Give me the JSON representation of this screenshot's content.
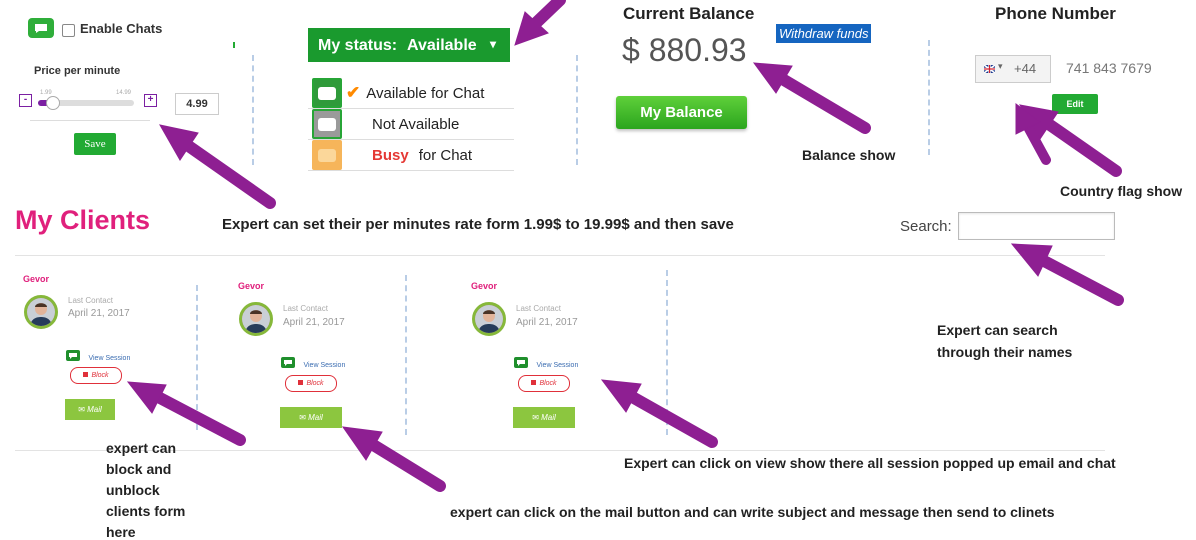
{
  "chat_settings": {
    "enable_label": "Enable Chats",
    "price_label": "Price per minute",
    "min_label": "1.99",
    "max_label": "14.99",
    "minus": "-",
    "plus": "+",
    "price_value": "4.99",
    "slider_level": 0.15,
    "save_label": "Save"
  },
  "status": {
    "header_label": "My status:",
    "current": "Available",
    "caret": "▾",
    "options": [
      {
        "label": "Available for Chat",
        "check": "✔"
      },
      {
        "label": "Not Available"
      },
      {
        "busy": "Busy",
        "label": "for Chat"
      }
    ]
  },
  "balance": {
    "title": "Current Balance",
    "amount": "$ 880.93",
    "withdraw_label": "Withdraw funds",
    "button_label": "My Balance"
  },
  "phone": {
    "title": "Phone Number",
    "flag_caret": "▾",
    "code": "+44",
    "number": "741 843 7679",
    "edit_label": "Edit"
  },
  "clients": {
    "title": "My Clients",
    "search_label": "Search:",
    "search_value": "",
    "items": [
      {
        "name": "Gevor",
        "last_contact_label": "Last Contact",
        "date": "April 21, 2017",
        "view_label": "View Session",
        "block_label": "Block",
        "mail_label": "Mail"
      },
      {
        "name": "Gevor",
        "last_contact_label": "Last Contact",
        "date": "April 21, 2017",
        "view_label": "View Session",
        "block_label": "Block",
        "mail_label": "Mail"
      },
      {
        "name": "Gevor",
        "last_contact_label": "Last Contact",
        "date": "April 21, 2017",
        "view_label": "View Session",
        "block_label": "Block",
        "mail_label": "Mail"
      }
    ]
  },
  "annotations": {
    "rate": "Expert can set their per minutes rate form 1.99$ to 19.99$ and then save",
    "balance": "Balance show",
    "flag": "Country flag show",
    "search_1": "Expert can search",
    "search_2": "through their names",
    "block_1": "expert can",
    "block_2": "block and",
    "block_3": "unblock",
    "block_4": "clients form",
    "block_5": "here",
    "view": "Expert can click on view show there all session popped up email and chat",
    "mail": "expert can click on the mail button and can write subject and message then send to clinets"
  },
  "colors": {
    "arrow": "#8e1f92",
    "accent_green": "#22aa33",
    "brand_pink": "#e0207c",
    "withdraw_bg": "#1565c0"
  }
}
